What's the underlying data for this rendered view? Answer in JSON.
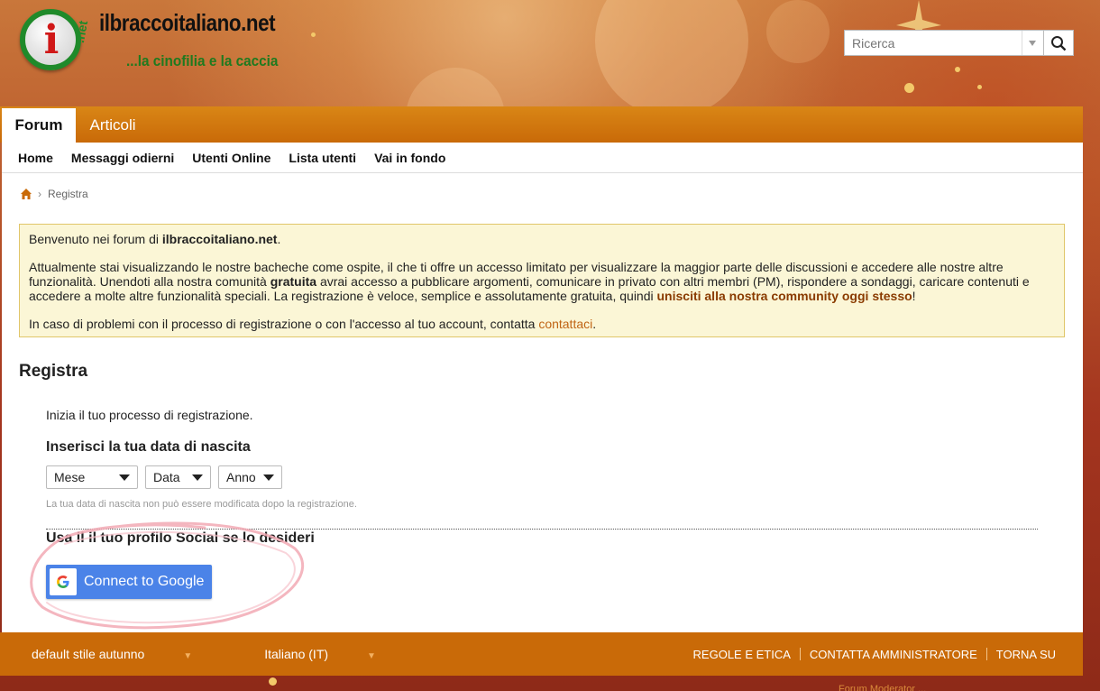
{
  "header": {
    "site_title": "ilbraccoitaliano.net",
    "slogan": "...la cinofilia e la caccia",
    "logo_letter": "i",
    "logo_suffix": ".net",
    "search": {
      "placeholder": "Ricerca"
    }
  },
  "nav": {
    "tabs": [
      {
        "label": "Forum",
        "active": true
      },
      {
        "label": "Articoli",
        "active": false
      }
    ],
    "links": [
      "Home",
      "Messaggi odierni",
      "Utenti Online",
      "Lista utenti",
      "Vai in fondo"
    ]
  },
  "breadcrumb": {
    "current": "Registra"
  },
  "notice": {
    "welcome_prefix": "Benvenuto nei forum di ",
    "welcome_site": "ilbraccoitaliano.net",
    "welcome_suffix": ".",
    "body_part1": "Attualmente stai visualizzando le nostre bacheche come ospite, il che ti offre un accesso limitato per visualizzare la maggior parte delle discussioni e accedere alle nostre altre funzionalità. Unendoti alla nostra comunità ",
    "body_bold": "gratuita",
    "body_part2": " avrai accesso a pubblicare argomenti, comunicare in privato con altri membri (PM), rispondere a sondaggi, caricare contenuti e accedere a molte altre funzionalità speciali. La registrazione è veloce, semplice e assolutamente gratuita, quindi ",
    "body_highlight": "unisciti alla nostra community oggi stesso",
    "body_end": "!",
    "problems_text": "In caso di problemi con il processo di registrazione o con l'accesso al tuo account, contatta ",
    "problems_link": "contattaci",
    "problems_end": "."
  },
  "register": {
    "title": "Registra",
    "intro": "Inizia il tuo processo di registrazione.",
    "birth_label": "Inserisci la tua data di nascita",
    "selects": {
      "month": "Mese",
      "day": "Data",
      "year": "Anno"
    },
    "birth_note": "La tua data di nascita non può essere modificata dopo la registrazione.",
    "social_label": "Usa il il tuo profilo Social se lo desideri",
    "google_button": "Connect to Google"
  },
  "footer": {
    "theme": "default stile autunno",
    "language": "Italiano (IT)",
    "links": [
      "REGOLE E ETICA",
      "CONTATTA AMMINISTRATORE",
      "TORNA SU"
    ],
    "credit": "Forum Moderator ..."
  },
  "colors": {
    "accent_orange": "#c96a08",
    "notice_bg": "#fbf6d6",
    "google_blue": "#4b83e8",
    "annotation_pink": "#f2a9b4"
  },
  "icons": [
    "search-icon",
    "home-icon",
    "dropdown-caret-icon",
    "google-icon"
  ]
}
